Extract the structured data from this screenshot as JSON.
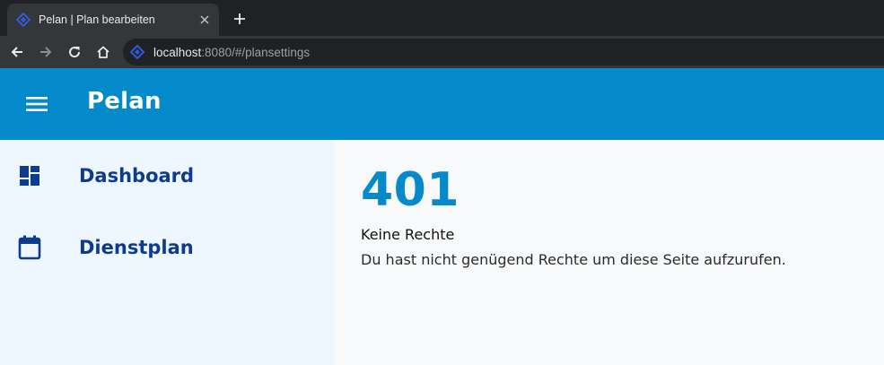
{
  "browser": {
    "tab": {
      "title": "Pelan | Plan bearbeiten",
      "favicon": "diamond-logo-icon",
      "close_icon": "close-icon"
    },
    "new_tab_icon": "plus-icon",
    "nav": {
      "back_icon": "arrow-left-icon",
      "forward_icon": "arrow-right-icon",
      "reload_icon": "reload-icon",
      "home_icon": "home-icon"
    },
    "url": {
      "host": "localhost",
      "rest": ":8080/#/plansettings"
    }
  },
  "app": {
    "title": "Pelan",
    "menu_icon": "hamburger-menu-icon",
    "accent_color": "#0489cb",
    "nav_text_color": "#0f3b8c"
  },
  "sidebar": {
    "items": [
      {
        "label": "Dashboard",
        "icon": "dashboard-icon"
      },
      {
        "label": "Dienstplan",
        "icon": "calendar-icon"
      }
    ]
  },
  "main": {
    "error_code": "401",
    "error_title": "Keine Rechte",
    "error_message": "Du hast nicht genügend Rechte um diese Seite aufzurufen."
  }
}
